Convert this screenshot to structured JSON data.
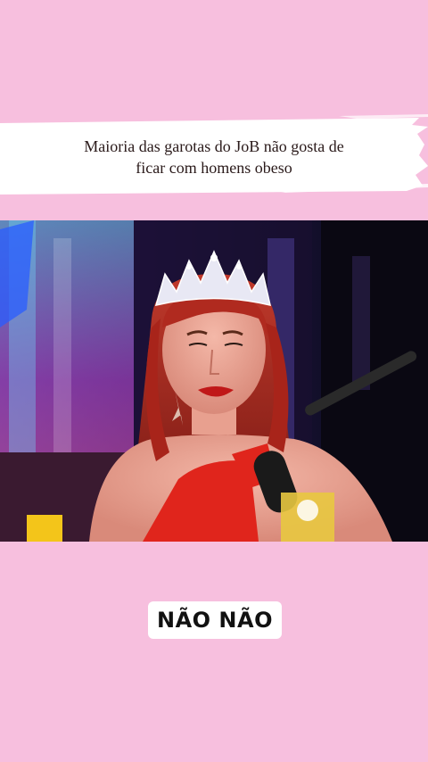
{
  "caption": {
    "line1": "Maioria das garotas do JoB não gosta de",
    "line2": "ficar com homens obeso"
  },
  "subtitle": {
    "text": "NÃO NÃO"
  },
  "colors": {
    "background": "#f7bfde",
    "caption_band": "#ffffff",
    "subtitle_bg": "#ffffff"
  }
}
